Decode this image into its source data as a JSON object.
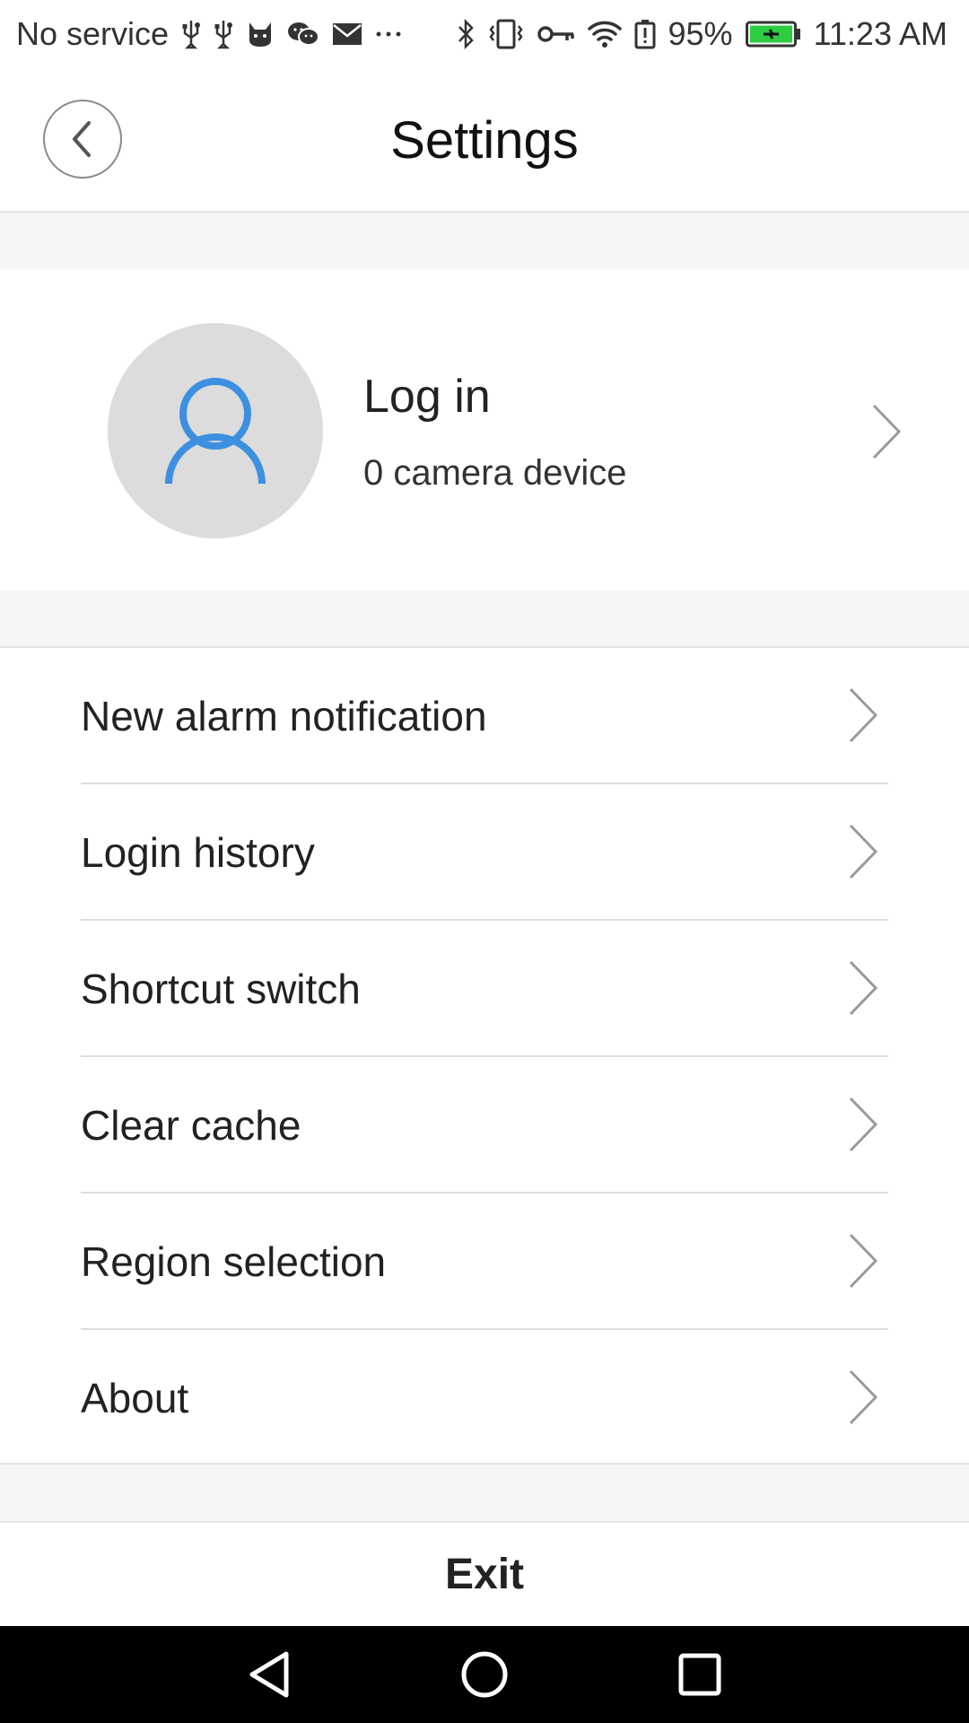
{
  "status_bar": {
    "carrier": "No service",
    "battery_percent": "95%",
    "time": "11:23 AM",
    "battery_color": "#2ecc40",
    "left_icons": [
      "usb-icon",
      "usb-icon",
      "cat-icon",
      "wechat-icon",
      "mail-icon",
      "more-icon"
    ],
    "right_icons": [
      "bluetooth-icon",
      "vibrate-icon",
      "key-icon",
      "wifi-icon",
      "battery-alert-icon",
      "battery-charging-icon"
    ]
  },
  "header": {
    "title": "Settings",
    "back_icon": "chevron-left-icon"
  },
  "profile": {
    "title": "Log in",
    "subtitle": "0 camera device",
    "avatar_icon": "user-icon",
    "accent_color": "#3d8fe0"
  },
  "settings_list": {
    "items": [
      {
        "label": "New alarm notification"
      },
      {
        "label": "Login history"
      },
      {
        "label": "Shortcut switch"
      },
      {
        "label": "Clear cache"
      },
      {
        "label": "Region selection"
      },
      {
        "label": "About"
      }
    ]
  },
  "exit": {
    "label": "Exit"
  },
  "nav_bar": {
    "buttons": [
      "back-triangle-icon",
      "home-circle-icon",
      "recents-square-icon"
    ]
  }
}
